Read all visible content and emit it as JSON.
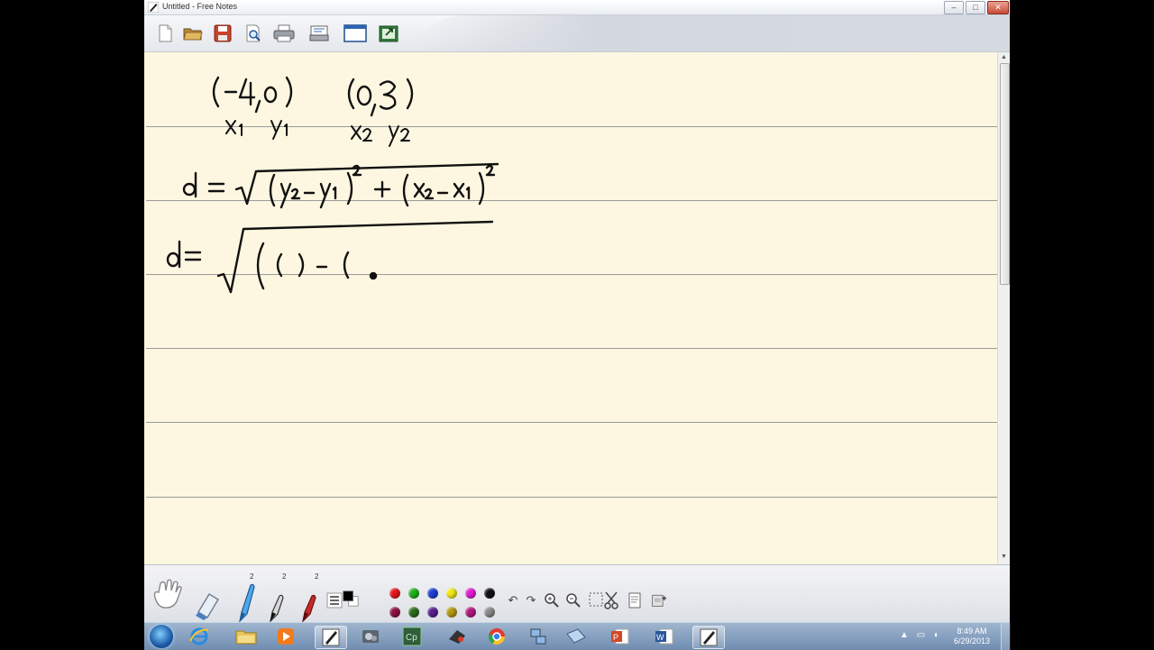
{
  "window": {
    "title": "Untitled - Free Notes"
  },
  "toolbar": {
    "buttons": [
      {
        "name": "new-document-icon"
      },
      {
        "name": "open-folder-icon"
      },
      {
        "name": "save-disk-icon"
      },
      {
        "name": "print-preview-icon"
      },
      {
        "name": "print-icon"
      },
      {
        "name": "page-setup-icon"
      },
      {
        "name": "window-icon"
      },
      {
        "name": "export-icon"
      }
    ]
  },
  "palette": {
    "pen_badges": [
      "2",
      "2",
      "2"
    ],
    "colors": {
      "row1": [
        "#e8141c",
        "#1eb31e",
        "#1f3ed6",
        "#f2ea13",
        "#e21ad6",
        "#111111"
      ],
      "row2": [
        "#8b1245",
        "#2e6b1c",
        "#5b1f8f",
        "#b59a12",
        "#b5177d",
        "#8a8a8a"
      ]
    }
  },
  "taskbar": {
    "clock_time": "8:49 AM",
    "clock_date": "6/29/2013"
  }
}
